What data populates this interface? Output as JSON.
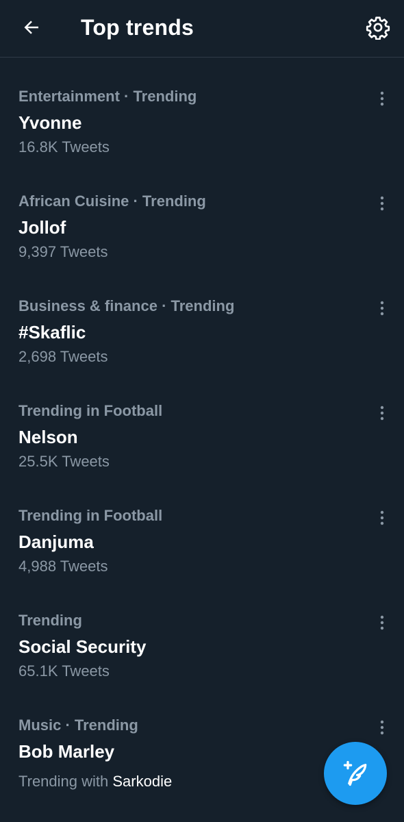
{
  "header": {
    "title": "Top trends",
    "back_icon": "arrow-left-icon",
    "settings_icon": "gear-icon"
  },
  "trends": [
    {
      "meta": "Entertainment · Trending",
      "name": "Yvonne",
      "count": "16.8K Tweets"
    },
    {
      "meta": "African Cuisine · Trending",
      "name": "Jollof",
      "count": "9,397 Tweets"
    },
    {
      "meta": "Business & finance · Trending",
      "name": "#Skaflic",
      "count": "2,698 Tweets"
    },
    {
      "meta": "Trending in Football",
      "name": "Nelson",
      "count": "25.5K Tweets"
    },
    {
      "meta": "Trending in Football",
      "name": "Danjuma",
      "count": "4,988 Tweets"
    },
    {
      "meta": "Trending",
      "name": "Social Security",
      "count": "65.1K Tweets"
    },
    {
      "meta": "Music · Trending",
      "name": "Bob Marley",
      "count_prefix": "Trending with ",
      "count_highlight": "Sarkodie"
    }
  ],
  "fab": {
    "icon": "compose-tweet-icon"
  },
  "colors": {
    "background": "#15202b",
    "secondary_text": "#8b98a5",
    "accent": "#1d9bf0",
    "divider": "#2f3b47"
  }
}
